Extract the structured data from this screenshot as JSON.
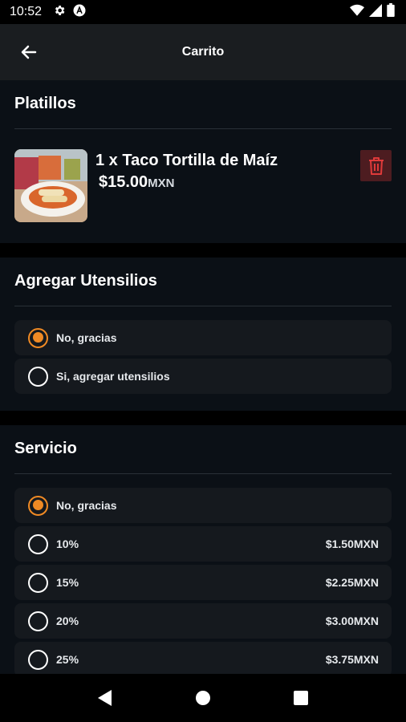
{
  "status_bar": {
    "time": "10:52",
    "icons": [
      "gear-icon",
      "a-circle-icon",
      "wifi-icon",
      "signal-icon",
      "battery-icon"
    ]
  },
  "app_bar": {
    "title": "Carrito",
    "back_icon": "arrow-left-icon"
  },
  "platillos": {
    "title": "Platillos",
    "items": [
      {
        "name": "1 x Taco Tortilla de Maíz",
        "price": "$15.00",
        "currency": "MXN",
        "delete_icon": "trash-icon"
      }
    ]
  },
  "utensilios": {
    "title": "Agregar Utensilios",
    "options": [
      {
        "label": "No, gracias",
        "selected": true
      },
      {
        "label": "Si, agregar utensilios",
        "selected": false
      }
    ]
  },
  "servicio": {
    "title": "Servicio",
    "options": [
      {
        "label": "No, gracias",
        "price": "",
        "selected": true
      },
      {
        "label": "10%",
        "price": "$1.50MXN",
        "selected": false
      },
      {
        "label": "15%",
        "price": "$2.25MXN",
        "selected": false
      },
      {
        "label": "20%",
        "price": "$3.00MXN",
        "selected": false
      },
      {
        "label": "25%",
        "price": "$3.75MXN",
        "selected": false
      }
    ]
  },
  "nav": {
    "icons": [
      "back-triangle-icon",
      "home-circle-icon",
      "recents-square-icon"
    ]
  },
  "colors": {
    "accent": "#f08a24",
    "background": "#0b1016",
    "delete_bg": "#4d1c20",
    "delete_icon": "#e03a3a"
  }
}
